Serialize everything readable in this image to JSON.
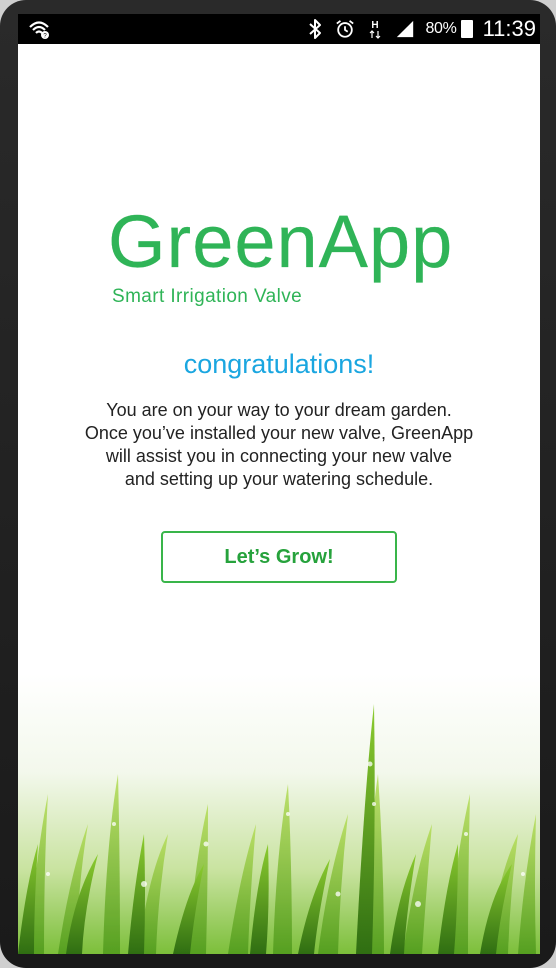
{
  "status_bar": {
    "battery_percent": "80%",
    "time": "11:39",
    "icons": [
      "wifi-icon",
      "bluetooth-icon",
      "alarm-icon",
      "hplus-signal-icon",
      "cell-signal-icon",
      "battery-icon"
    ]
  },
  "logo": {
    "wordmark": "GreenApp",
    "tagline": "Smart Irrigation Valve"
  },
  "headline": "congratulations!",
  "body_lines": [
    "You are on your way to your dream garden.",
    "Once you’ve installed your new valve, GreenApp",
    "will assist you in connecting your new valve",
    "and setting up your watering schedule."
  ],
  "cta_label": "Let’s Grow!",
  "colors": {
    "brand_green": "#2fb457",
    "headline_blue": "#1aa6e0",
    "button_border": "#39b54a",
    "status_bar": "#000000"
  }
}
